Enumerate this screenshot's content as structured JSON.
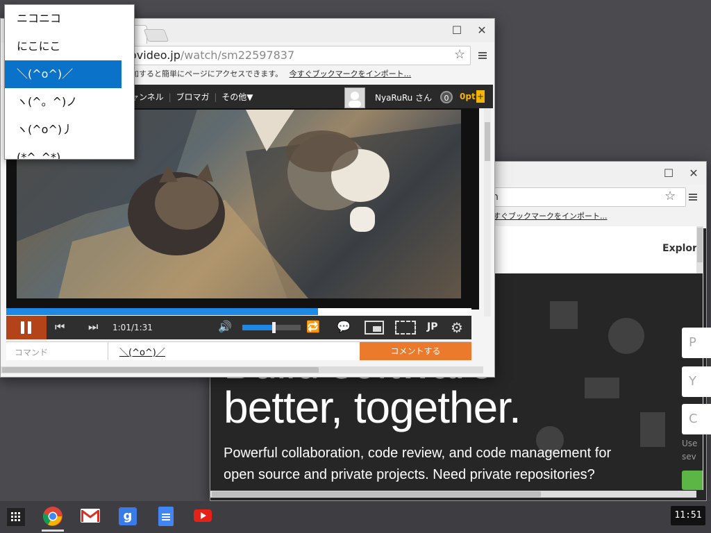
{
  "popup_list": {
    "items": [
      "ニコニコ",
      "にこにこ",
      "＼(^o^)／",
      "ヽ(^。^)ノ",
      "ヽ(^o^)丿",
      "(*^_^*)"
    ],
    "selected_index": 2
  },
  "nico_window": {
    "address_host": "ovideo.jp",
    "address_path": "/watch/sm22597837",
    "bookmark_text": "追加すると簡単にページにアクセスできます。",
    "bookmark_link": "今すぐブックマークをインポート...",
    "nav": {
      "channel": "ャンネル",
      "blomaga": "ブロマガ",
      "other": "その他▼",
      "username": "NyaRuRu さん",
      "points_count": "0",
      "points_label": "0pt"
    },
    "player": {
      "time": "1:01/1:31",
      "progress": 0.67,
      "volume": 0.55,
      "lang": "JP"
    },
    "comment": {
      "command_placeholder": "コマンド",
      "value": "＼(^o^)／",
      "submit": "コメントする"
    }
  },
  "github_window": {
    "address_partial": "n",
    "bookmark_link": "すぐブックマークをインポート...",
    "explore": "Explore",
    "hero_line1": "Build software",
    "hero_line2": "better, together.",
    "hero_desc_line1": "Powerful collaboration, code review, and code management for",
    "hero_desc_line2": "open source and private projects. Need private repositories?",
    "field_letters": [
      "P",
      "Y",
      "C"
    ],
    "note_line1": "Use",
    "note_line2": "sev"
  },
  "shelf": {
    "clock": "11:51",
    "apps": [
      "apps-launcher-icon",
      "chrome-icon",
      "gmail-icon",
      "google-search-icon",
      "google-docs-icon",
      "youtube-icon"
    ]
  },
  "colors": {
    "nico_orange": "#ec7a2c",
    "selection_blue": "#0a73c9",
    "player_progress": "#1e88e5",
    "desktop": "#4a4a4f"
  }
}
